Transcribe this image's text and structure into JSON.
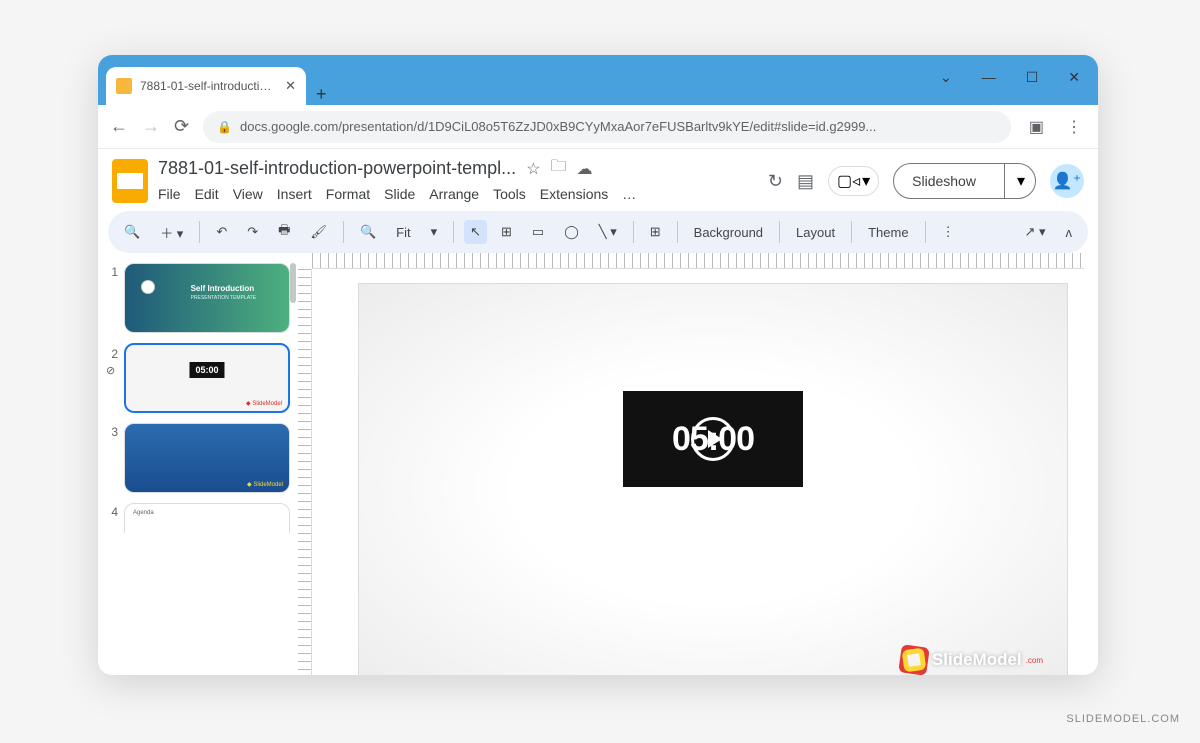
{
  "window": {
    "tab_title": "7881-01-self-introduction-powe",
    "url": "docs.google.com/presentation/d/1D9CiL08o5T6ZzJD0xB9CYyMxaAor7eFUSBarltv9kYE/edit#slide=id.g2999..."
  },
  "header": {
    "doc_title": "7881-01-self-introduction-powerpoint-templ...",
    "slideshow_label": "Slideshow"
  },
  "menu": {
    "file": "File",
    "edit": "Edit",
    "view": "View",
    "insert": "Insert",
    "format": "Format",
    "slide": "Slide",
    "arrange": "Arrange",
    "tools": "Tools",
    "extensions": "Extensions",
    "more": "…"
  },
  "toolbar": {
    "zoom_label": "Fit",
    "background": "Background",
    "layout": "Layout",
    "theme": "Theme"
  },
  "panel": {
    "slides": [
      {
        "num": "1",
        "title": "Self Introduction",
        "subtitle": "PRESENTATION TEMPLATE"
      },
      {
        "num": "2",
        "badge": "05:00"
      },
      {
        "num": "3"
      },
      {
        "num": "4",
        "header": "Agenda"
      }
    ]
  },
  "canvas": {
    "video_time": "05:00",
    "logo_text": "SlideModel",
    "logo_suffix": ".com"
  },
  "watermark": "SLIDEMODEL.COM"
}
